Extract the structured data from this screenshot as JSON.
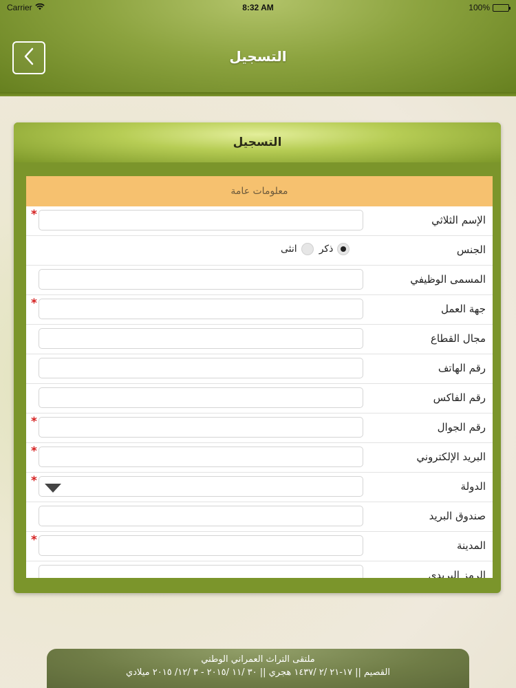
{
  "status_bar": {
    "carrier": "Carrier",
    "time": "8:32 AM",
    "battery": "100%",
    "battery_level": 1.0
  },
  "nav": {
    "title": "التسجيل"
  },
  "card": {
    "title": "التسجيل",
    "section": "معلومات عامة"
  },
  "form": {
    "rows": [
      {
        "label": "الإسم الثلاثي",
        "type": "text",
        "required": true
      },
      {
        "label": "الجنس",
        "type": "radio",
        "options": [
          {
            "label": "ذكر",
            "checked": true
          },
          {
            "label": "انثى",
            "checked": false
          }
        ]
      },
      {
        "label": "المسمى الوظيفي",
        "type": "text",
        "required": false
      },
      {
        "label": "جهة العمل",
        "type": "text",
        "required": true
      },
      {
        "label": "مجال القطاع",
        "type": "text",
        "required": false
      },
      {
        "label": "رقم الهاتف",
        "type": "text",
        "required": false
      },
      {
        "label": "رقم الفاكس",
        "type": "text",
        "required": false
      },
      {
        "label": "رقم الجوال",
        "type": "text",
        "required": true
      },
      {
        "label": "البريد الإلكتروني",
        "type": "text",
        "required": true
      },
      {
        "label": "الدولة",
        "type": "select",
        "required": true
      },
      {
        "label": "صندوق البريد",
        "type": "text",
        "required": false
      },
      {
        "label": "المدينة",
        "type": "text",
        "required": true
      },
      {
        "label": "الرمز البريدي",
        "type": "text",
        "required": false
      }
    ],
    "required_symbol": "*"
  },
  "footer": {
    "line1": "ملتقى التراث العمراني الوطني",
    "line2": "القصيم || ١٧-٢١ /٢ /١٤٣٧ هجري || ٣٠ /١١ /٢٠١٥ - ٣ /١٢/ ٢٠١٥ ميلادي"
  },
  "colors": {
    "accent": "#7b952b",
    "section_header": "#f6c16f",
    "required": "#d52020"
  }
}
